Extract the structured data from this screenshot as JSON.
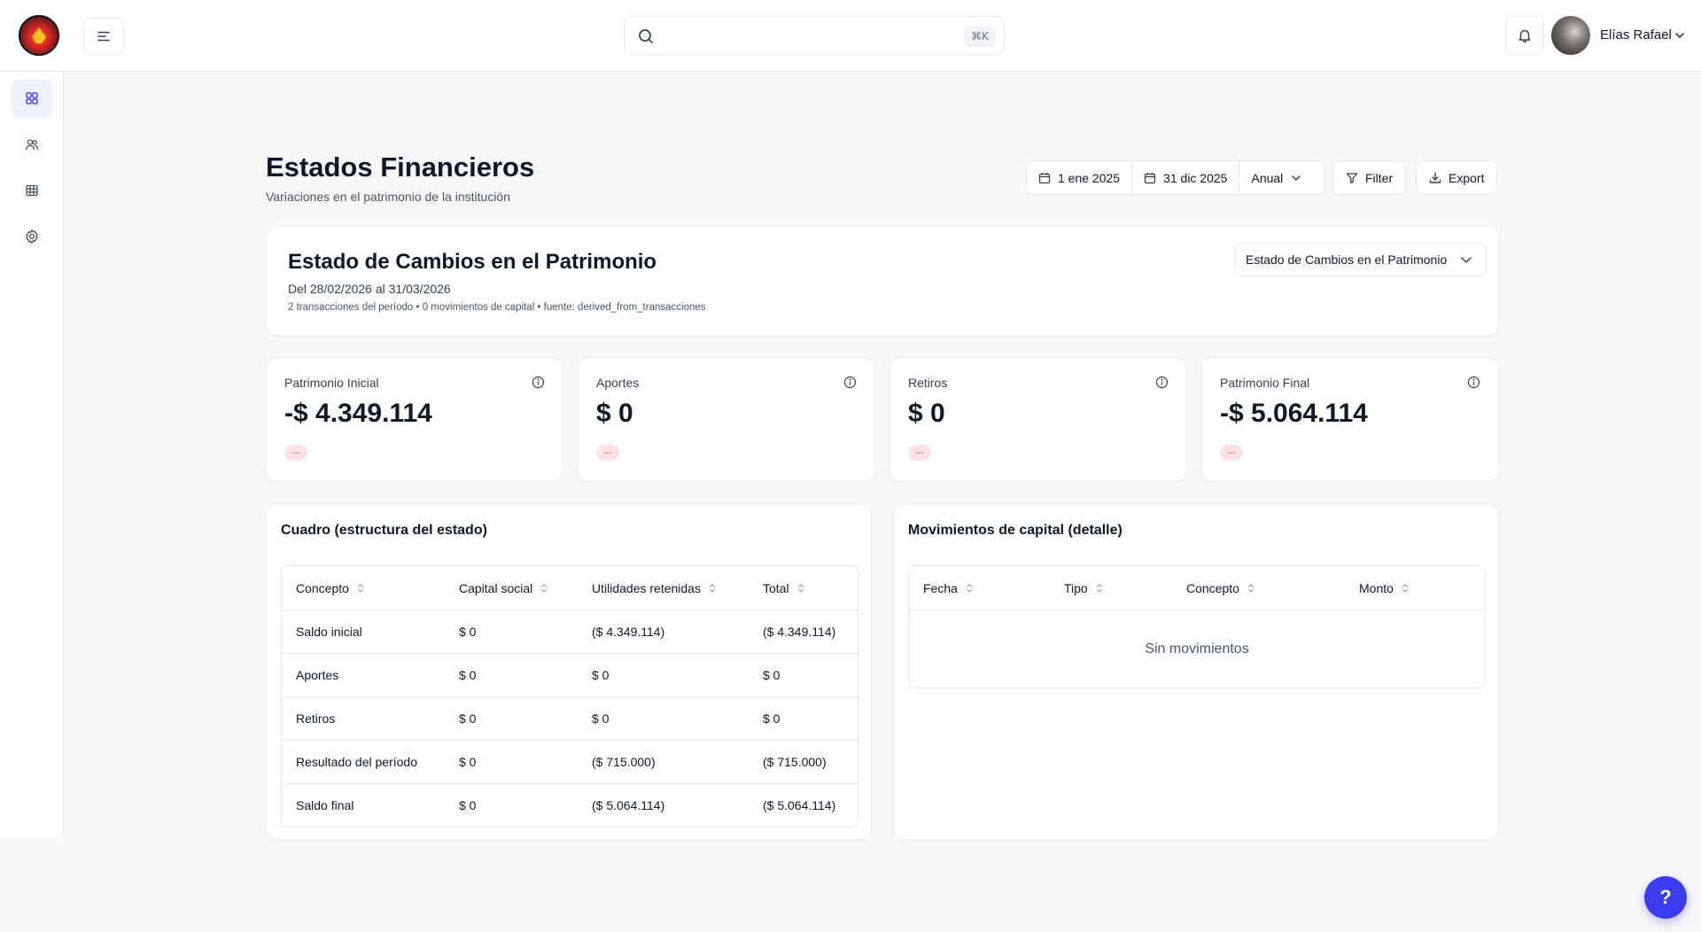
{
  "header": {
    "search_placeholder": "",
    "shortcut": "⌘K",
    "user_name": "Elías Rafael"
  },
  "sidebar": {
    "items": [
      {
        "icon": "dashboard-grid-icon",
        "active": true
      },
      {
        "icon": "users-icon",
        "active": false
      },
      {
        "icon": "table-icon",
        "active": false
      },
      {
        "icon": "gear-icon",
        "active": false
      }
    ]
  },
  "page": {
    "title": "Estados Financieros",
    "subtitle": "Variaciones en el patrimonio de la institución"
  },
  "toolbar": {
    "date_from": "1 ene 2025",
    "date_to": "31 dic 2025",
    "period": "Anual",
    "filter_label": "Filter",
    "export_label": "Export"
  },
  "report": {
    "title": "Estado de Cambios en el Patrimonio",
    "range": "Del 28/02/2026 al 31/03/2026",
    "meta": "2 transacciones del período • 0 movimientos de capital • fuente: derived_from_transacciones",
    "selector": "Estado de Cambios en el Patrimonio"
  },
  "kpis": [
    {
      "label": "Patrimonio Inicial",
      "value": "-$ 4.349.114",
      "badge": "..."
    },
    {
      "label": "Aportes",
      "value": "$ 0",
      "badge": "..."
    },
    {
      "label": "Retiros",
      "value": "$ 0",
      "badge": "..."
    },
    {
      "label": "Patrimonio Final",
      "value": "-$ 5.064.114",
      "badge": "..."
    }
  ],
  "cuadro": {
    "title": "Cuadro (estructura del estado)",
    "columns": [
      "Concepto",
      "Capital social",
      "Utilidades retenidas",
      "Total"
    ],
    "rows": [
      [
        "Saldo inicial",
        "$ 0",
        "($ 4.349.114)",
        "($ 4.349.114)"
      ],
      [
        "Aportes",
        "$ 0",
        "$ 0",
        "$ 0"
      ],
      [
        "Retiros",
        "$ 0",
        "$ 0",
        "$ 0"
      ],
      [
        "Resultado del período",
        "$ 0",
        "($ 715.000)",
        "($ 715.000)"
      ],
      [
        "Saldo final",
        "$ 0",
        "($ 5.064.114)",
        "($ 5.064.114)"
      ]
    ]
  },
  "movimientos": {
    "title": "Movimientos de capital (detalle)",
    "columns": [
      "Fecha",
      "Tipo",
      "Concepto",
      "Monto"
    ],
    "empty_text": "Sin movimientos"
  },
  "help_label": "?",
  "colors": {
    "accent": "#3b3bf0",
    "badge_bg": "#fee2e2",
    "badge_fg": "#b91c1c",
    "sidebar_active": "#eef2ff"
  }
}
